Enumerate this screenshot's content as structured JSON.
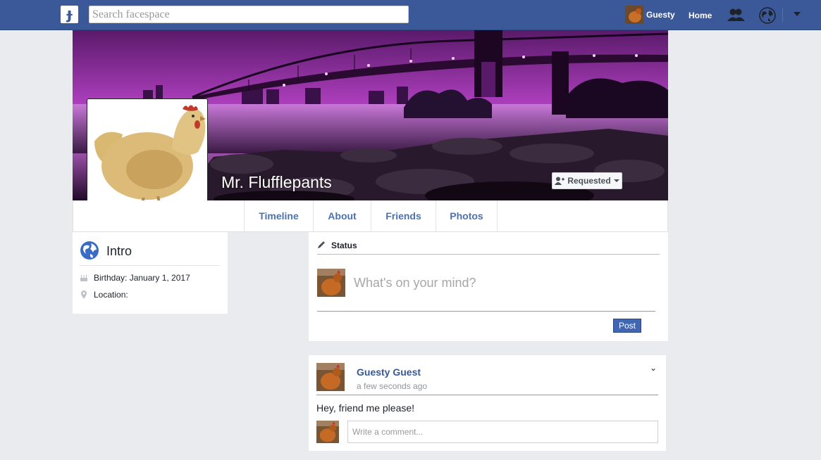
{
  "topbar": {
    "logo_glyph": "ɟ",
    "search_placeholder": "Search facespace",
    "user_name": "Guesty",
    "home_label": "Home",
    "icons": [
      "friends-icon",
      "globe-icon",
      "caret-down-icon"
    ]
  },
  "profile": {
    "name": "Mr. Flufflepants",
    "requested_label": "Requested"
  },
  "tabs": [
    {
      "label": "Timeline"
    },
    {
      "label": "About"
    },
    {
      "label": "Friends"
    },
    {
      "label": "Photos"
    }
  ],
  "intro": {
    "title": "Intro",
    "birthday": "Birthday: January 1, 2017",
    "location": "Location:"
  },
  "composer": {
    "label": "Status",
    "placeholder": "What's on your mind?",
    "post_label": "Post"
  },
  "post": {
    "author": "Guesty Guest",
    "time": "a few seconds ago",
    "text": "Hey, friend me please!",
    "comment_placeholder": "Write a comment..."
  },
  "colors": {
    "brand": "#3b5998",
    "background": "#e9ebee",
    "link": "#365899",
    "cover_accent": "#c040d0"
  }
}
